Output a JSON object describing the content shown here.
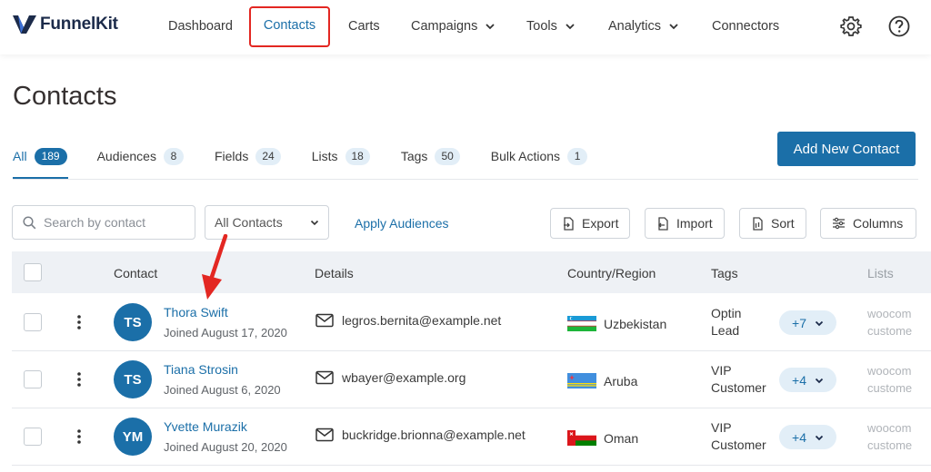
{
  "app": {
    "logo_text": "FunnelKit"
  },
  "nav": {
    "items": [
      {
        "label": "Dashboard"
      },
      {
        "label": "Contacts"
      },
      {
        "label": "Carts"
      },
      {
        "label": "Campaigns"
      },
      {
        "label": "Tools"
      },
      {
        "label": "Analytics"
      },
      {
        "label": "Connectors"
      }
    ],
    "active": "Contacts"
  },
  "page": {
    "title": "Contacts"
  },
  "tabs": [
    {
      "label": "All",
      "count": "189"
    },
    {
      "label": "Audiences",
      "count": "8"
    },
    {
      "label": "Fields",
      "count": "24"
    },
    {
      "label": "Lists",
      "count": "18"
    },
    {
      "label": "Tags",
      "count": "50"
    },
    {
      "label": "Bulk Actions",
      "count": "1"
    }
  ],
  "actions": {
    "add_new_contact": "Add New Contact",
    "apply_audiences": "Apply Audiences",
    "export": "Export",
    "import": "Import",
    "sort": "Sort",
    "columns": "Columns"
  },
  "filters": {
    "search_placeholder": "Search by contact",
    "select_value": "All Contacts"
  },
  "table": {
    "headers": {
      "contact": "Contact",
      "details": "Details",
      "country": "Country/Region",
      "tags": "Tags",
      "lists": "Lists"
    },
    "rows": [
      {
        "initials": "TS",
        "name": "Thora Swift",
        "joined": "Joined August 17, 2020",
        "email": "legros.bernita@example.net",
        "country": "Uzbekistan",
        "tag_line1": "Optin",
        "tag_line2": "Lead",
        "tag_more": "+7",
        "list_line1": "woocom",
        "list_line2": "custome"
      },
      {
        "initials": "TS",
        "name": "Tiana Strosin",
        "joined": "Joined August 6, 2020",
        "email": "wbayer@example.org",
        "country": "Aruba",
        "tag_line1": "VIP",
        "tag_line2": "Customer",
        "tag_more": "+4",
        "list_line1": "woocom",
        "list_line2": "custome"
      },
      {
        "initials": "YM",
        "name": "Yvette Murazik",
        "joined": "Joined August 20, 2020",
        "email": "buckridge.brionna@example.net",
        "country": "Oman",
        "tag_line1": "VIP",
        "tag_line2": "Customer",
        "tag_more": "+4",
        "list_line1": "woocom",
        "list_line2": "custome"
      }
    ]
  },
  "colors": {
    "primary": "#1b6fa8",
    "highlight": "#e32722",
    "text": "#353030"
  }
}
